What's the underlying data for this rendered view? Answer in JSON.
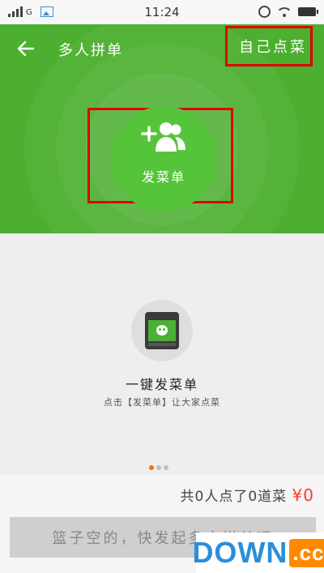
{
  "status_bar": {
    "network": "G",
    "time": "11:24"
  },
  "header": {
    "title": "多人拼单",
    "back_icon": "arrow-left-icon",
    "self_order_label": "自己点菜",
    "send_order_label": "发菜单",
    "send_icon": "add-people-icon",
    "colors": {
      "header_bg": "#4caf2f",
      "highlight_border": "#e00000"
    }
  },
  "promo": {
    "title": "一键发菜单",
    "subtitle": "点击【发菜单】让大家点菜",
    "icon": "wechat-phone-icon",
    "pager": {
      "count": 3,
      "active_index": 0
    }
  },
  "summary": {
    "text": "共0人点了0道菜",
    "price": "¥0",
    "price_color": "#ff3b30"
  },
  "submit_button": {
    "label": "篮子空的，快发起多人拼单吧"
  },
  "watermark": {
    "brand": "DOWN",
    "suffix": ".cc"
  }
}
